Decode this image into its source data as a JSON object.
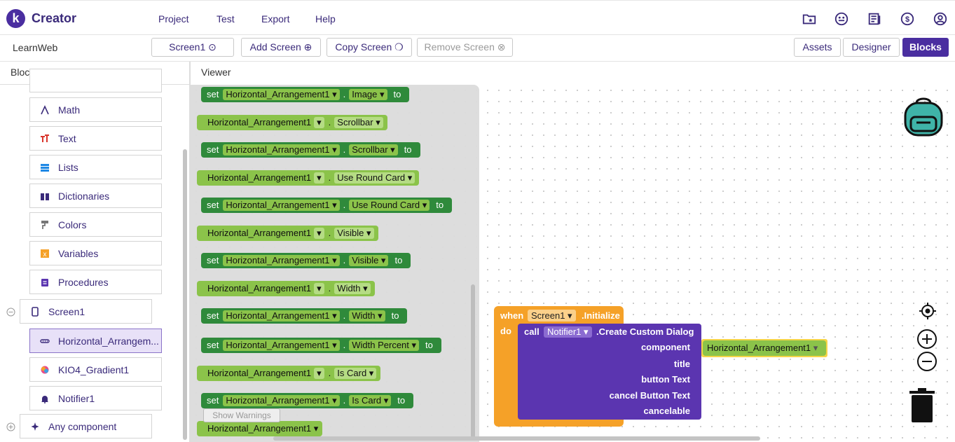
{
  "app": {
    "brand": "Creator",
    "logo_letter": "k"
  },
  "menu": [
    "Project",
    "Test",
    "Export",
    "Help"
  ],
  "top_icons": [
    "folder-star-icon",
    "emoji-icon",
    "news-icon",
    "dollar-icon",
    "account-icon"
  ],
  "toolbar": {
    "project_name": "LearnWeb",
    "screen_select": "Screen1 ⊙",
    "add_screen": "Add Screen ⊕",
    "copy_screen": "Copy Screen ❍",
    "remove_screen": "Remove Screen ⊗",
    "assets": "Assets",
    "designer": "Designer",
    "blocks": "Blocks"
  },
  "panels": {
    "blocks_title": "Blocks",
    "viewer_title": "Viewer"
  },
  "builtin_blocks": [
    {
      "label": "Math",
      "icon": "math-icon",
      "color": "#3a2a7a"
    },
    {
      "label": "Text",
      "icon": "text-icon",
      "color": "#d9342b"
    },
    {
      "label": "Lists",
      "icon": "list-icon",
      "color": "#1e88e5"
    },
    {
      "label": "Dictionaries",
      "icon": "dictionary-icon",
      "color": "#3a2a7a"
    },
    {
      "label": "Colors",
      "icon": "paint-roller-icon",
      "color": "#777777"
    },
    {
      "label": "Variables",
      "icon": "variable-icon",
      "color": "#f5a128"
    },
    {
      "label": "Procedures",
      "icon": "procedure-icon",
      "color": "#5b35b0"
    }
  ],
  "component_tree": {
    "screen": "Screen1",
    "components": [
      {
        "label": "Horizontal_Arrangem...",
        "icon": "arrangement-icon",
        "selected": true
      },
      {
        "label": "KIO4_Gradient1",
        "icon": "gradient-icon",
        "selected": false
      },
      {
        "label": "Notifier1",
        "icon": "bell-icon",
        "selected": false
      }
    ],
    "any_component": "Any component"
  },
  "flyout_blocks": [
    {
      "kind": "set",
      "component": "Horizontal_Arrangement1",
      "property": "Image"
    },
    {
      "kind": "get",
      "component": "Horizontal_Arrangement1",
      "property": "Scrollbar"
    },
    {
      "kind": "set",
      "component": "Horizontal_Arrangement1",
      "property": "Scrollbar"
    },
    {
      "kind": "get",
      "component": "Horizontal_Arrangement1",
      "property": "Use Round Card"
    },
    {
      "kind": "set",
      "component": "Horizontal_Arrangement1",
      "property": "Use Round Card"
    },
    {
      "kind": "get",
      "component": "Horizontal_Arrangement1",
      "property": "Visible"
    },
    {
      "kind": "set",
      "component": "Horizontal_Arrangement1",
      "property": "Visible"
    },
    {
      "kind": "get",
      "component": "Horizontal_Arrangement1",
      "property": "Width"
    },
    {
      "kind": "set",
      "component": "Horizontal_Arrangement1",
      "property": "Width"
    },
    {
      "kind": "set",
      "component": "Horizontal_Arrangement1",
      "property": "Width Percent"
    },
    {
      "kind": "get",
      "component": "Horizontal_Arrangement1",
      "property": "Is Card"
    },
    {
      "kind": "set",
      "component": "Horizontal_Arrangement1",
      "property": "Is Card"
    },
    {
      "kind": "comp",
      "component": "Horizontal_Arrangement1",
      "property": ""
    }
  ],
  "block_keywords": {
    "set": "set",
    "to": "to",
    "dot": "."
  },
  "show_warnings": "Show Warnings",
  "event_block": {
    "when": "when",
    "component": "Screen1",
    "event": ".Initialize",
    "do": "do",
    "call": "call",
    "call_component": "Notifier1",
    "method": ".Create Custom Dialog",
    "params": [
      "component",
      "title",
      "button Text",
      "cancel Button Text",
      "cancelable"
    ],
    "component_arg": "Horizontal_Arrangement1"
  },
  "colors": {
    "accent": "#4a2ea0",
    "set_block": "#2f8a3b",
    "get_block": "#8bc34a",
    "event": "#f5a128",
    "call": "#5b35b0",
    "highlight": "#f5d547"
  }
}
